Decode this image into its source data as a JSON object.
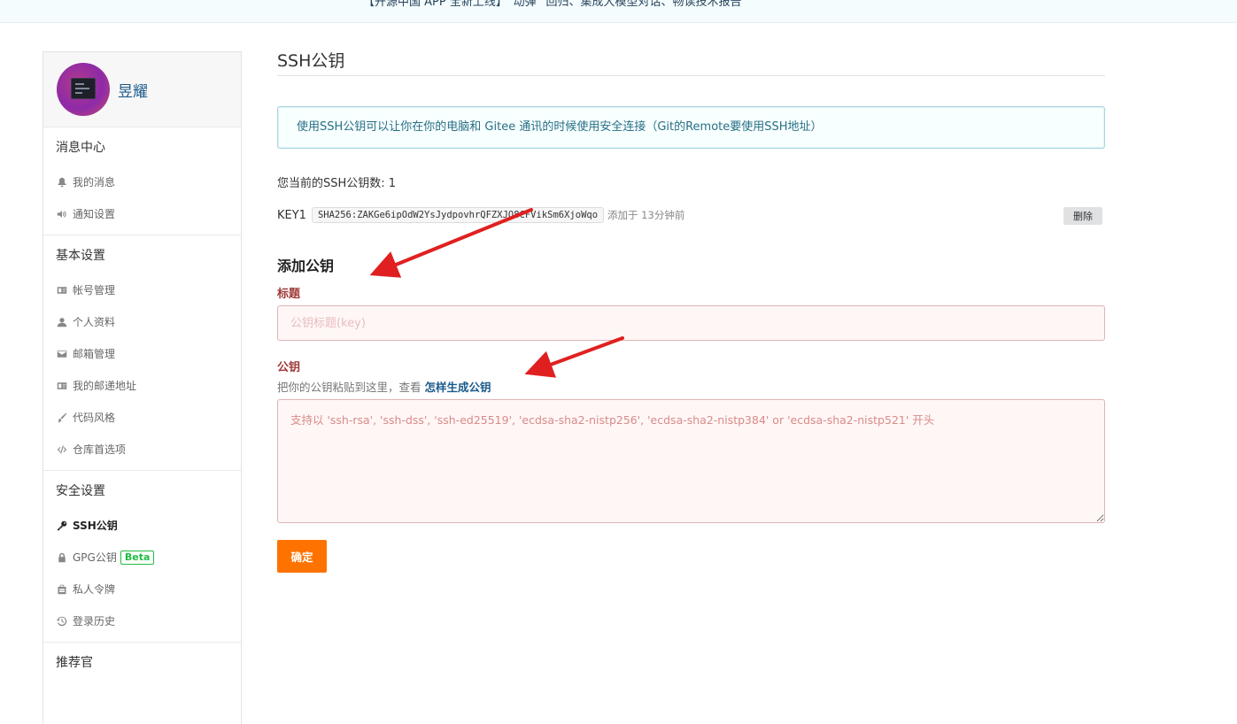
{
  "banner": {
    "text": "【开源中国 APP 全新上线】“动弹” 回归、集成大模型对话、畅读技术报告"
  },
  "sidebar": {
    "username": "昱耀",
    "sections": [
      {
        "title": "消息中心",
        "items": [
          {
            "label": "我的消息",
            "icon": "bell-icon"
          },
          {
            "label": "通知设置",
            "icon": "volume-icon"
          }
        ]
      },
      {
        "title": "基本设置",
        "items": [
          {
            "label": "帐号管理",
            "icon": "id-card-icon"
          },
          {
            "label": "个人资料",
            "icon": "user-icon"
          },
          {
            "label": "邮箱管理",
            "icon": "envelope-icon"
          },
          {
            "label": "我的邮递地址",
            "icon": "address-card-icon"
          },
          {
            "label": "代码风格",
            "icon": "paint-brush-icon"
          },
          {
            "label": "仓库首选项",
            "icon": "code-icon"
          }
        ]
      },
      {
        "title": "安全设置",
        "items": [
          {
            "label": "SSH公钥",
            "icon": "key-icon",
            "active": true
          },
          {
            "label": "GPG公钥",
            "icon": "lock-icon",
            "badge": "Beta"
          },
          {
            "label": "私人令牌",
            "icon": "token-icon"
          },
          {
            "label": "登录历史",
            "icon": "history-icon"
          }
        ]
      },
      {
        "title": "推荐官",
        "items": []
      }
    ]
  },
  "main": {
    "title": "SSH公钥",
    "info": "使用SSH公钥可以让你在你的电脑和 Gitee 通讯的时候使用安全连接（Git的Remote要使用SSH地址）",
    "count_text": "您当前的SSH公钥数: 1",
    "key": {
      "name": "KEY1",
      "fingerprint": "SHA256:ZAKGe6ipOdW2YsJydpovhrQFZXJO8CFVikSm6XjoWqo",
      "time": "添加于 13分钟前",
      "delete_label": "删除"
    },
    "add_title": "添加公钥",
    "title_label": "标题",
    "title_placeholder": "公钥标题(key)",
    "key_label": "公钥",
    "hint_prefix": "把你的公钥粘贴到这里，查看",
    "hint_link": "怎样生成公钥",
    "key_placeholder": "支持以 'ssh-rsa', 'ssh-dss', 'ssh-ed25519', 'ecdsa-sha2-nistp256', 'ecdsa-sha2-nistp384' or 'ecdsa-sha2-nistp521' 开头",
    "submit_label": "确定"
  },
  "colors": {
    "accent": "#fe7300",
    "error": "#9f3a38",
    "link": "#1a5a8a",
    "arrow": "#e02020"
  }
}
